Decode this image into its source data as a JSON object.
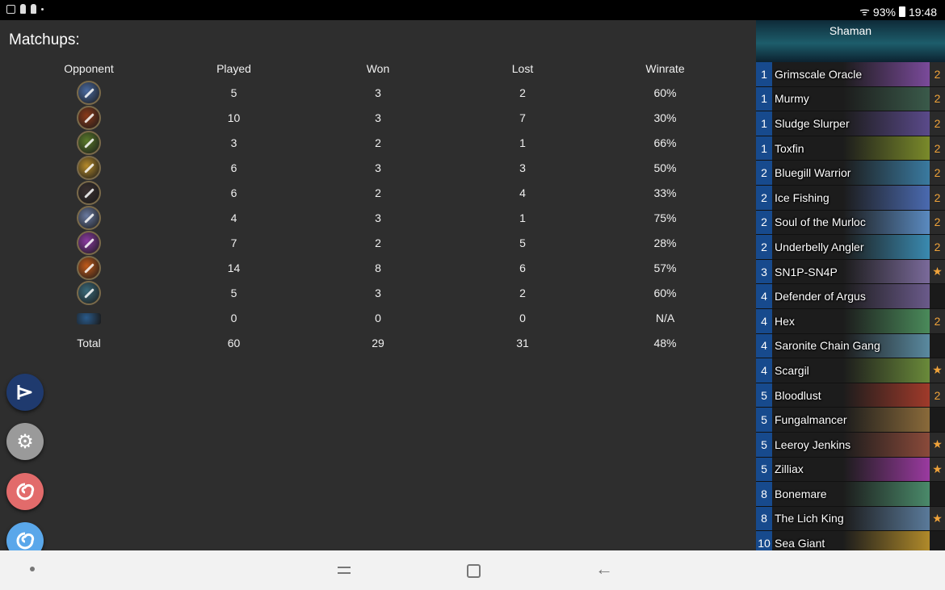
{
  "status_bar": {
    "battery": "93%",
    "time": "19:48"
  },
  "main": {
    "title": "Matchups:",
    "columns": [
      "Opponent",
      "Played",
      "Won",
      "Lost",
      "Winrate"
    ],
    "rows": [
      {
        "icon": "warrior-class-icon",
        "color": "#4a6aa0",
        "played": "5",
        "won": "3",
        "lost": "2",
        "winrate": "60%"
      },
      {
        "icon": "druid-class-icon",
        "color": "#8a3a1a",
        "played": "10",
        "won": "3",
        "lost": "7",
        "winrate": "30%"
      },
      {
        "icon": "hunter-class-icon",
        "color": "#5a7a2a",
        "played": "3",
        "won": "2",
        "lost": "1",
        "winrate": "66%"
      },
      {
        "icon": "paladin-class-icon",
        "color": "#b58a2a",
        "played": "6",
        "won": "3",
        "lost": "3",
        "winrate": "50%"
      },
      {
        "icon": "rogue-class-icon",
        "color": "#3a3030",
        "played": "6",
        "won": "2",
        "lost": "4",
        "winrate": "33%"
      },
      {
        "icon": "shaman-class-icon",
        "color": "#6a7aa0",
        "played": "4",
        "won": "3",
        "lost": "1",
        "winrate": "75%"
      },
      {
        "icon": "priest-class-icon",
        "color": "#8a3aa0",
        "played": "7",
        "won": "2",
        "lost": "5",
        "winrate": "28%"
      },
      {
        "icon": "mage-class-icon",
        "color": "#c05a1a",
        "played": "14",
        "won": "8",
        "lost": "6",
        "winrate": "57%"
      },
      {
        "icon": "warlock-class-icon",
        "color": "#3a6a7a",
        "played": "5",
        "won": "3",
        "lost": "2",
        "winrate": "60%"
      },
      {
        "icon": "unknown-class-icon",
        "color": "#2a5a8a",
        "played": "0",
        "won": "0",
        "lost": "0",
        "winrate": "N/A"
      }
    ],
    "total": {
      "label": "Total",
      "played": "60",
      "won": "29",
      "lost": "31",
      "winrate": "48%"
    }
  },
  "fabs": [
    "deck-tracker-icon",
    "gear-icon",
    "hearthstone-red-icon",
    "hearthstone-blue-icon"
  ],
  "deck": {
    "class_name": "Shaman",
    "cards": [
      {
        "cost": "1",
        "name": "Grimscale Oracle",
        "count": "2",
        "color": "#7a4a9a"
      },
      {
        "cost": "1",
        "name": "Murmy",
        "count": "2",
        "color": "#3a5a4a"
      },
      {
        "cost": "1",
        "name": "Sludge Slurper",
        "count": "2",
        "color": "#5a4a8a"
      },
      {
        "cost": "1",
        "name": "Toxfin",
        "count": "2",
        "color": "#7a8a2a"
      },
      {
        "cost": "2",
        "name": "Bluegill Warrior",
        "count": "2",
        "color": "#3a7aa0"
      },
      {
        "cost": "2",
        "name": "Ice Fishing",
        "count": "2",
        "color": "#4a6ab0"
      },
      {
        "cost": "2",
        "name": "Soul of the Murloc",
        "count": "2",
        "color": "#5a8ac0"
      },
      {
        "cost": "2",
        "name": "Underbelly Angler",
        "count": "2",
        "color": "#3a8ab0"
      },
      {
        "cost": "3",
        "name": "SN1P-SN4P",
        "count": "★",
        "color": "#7a6a9a"
      },
      {
        "cost": "4",
        "name": "Defender of Argus",
        "count": "",
        "color": "#6a5a8a"
      },
      {
        "cost": "4",
        "name": "Hex",
        "count": "2",
        "color": "#4a8a5a"
      },
      {
        "cost": "4",
        "name": "Saronite Chain Gang",
        "count": "",
        "color": "#5a8aa0"
      },
      {
        "cost": "4",
        "name": "Scargil",
        "count": "★",
        "color": "#6a8a3a"
      },
      {
        "cost": "5",
        "name": "Bloodlust",
        "count": "2",
        "color": "#a03a2a"
      },
      {
        "cost": "5",
        "name": "Fungalmancer",
        "count": "",
        "color": "#8a6a3a"
      },
      {
        "cost": "5",
        "name": "Leeroy Jenkins",
        "count": "★",
        "color": "#8a4a3a"
      },
      {
        "cost": "5",
        "name": "Zilliax",
        "count": "★",
        "color": "#9a3aa0"
      },
      {
        "cost": "8",
        "name": "Bonemare",
        "count": "",
        "color": "#4a8a6a"
      },
      {
        "cost": "8",
        "name": "The Lich King",
        "count": "★",
        "color": "#5a7a9a"
      },
      {
        "cost": "10",
        "name": "Sea Giant",
        "count": "",
        "color": "#b08a2a"
      }
    ]
  }
}
